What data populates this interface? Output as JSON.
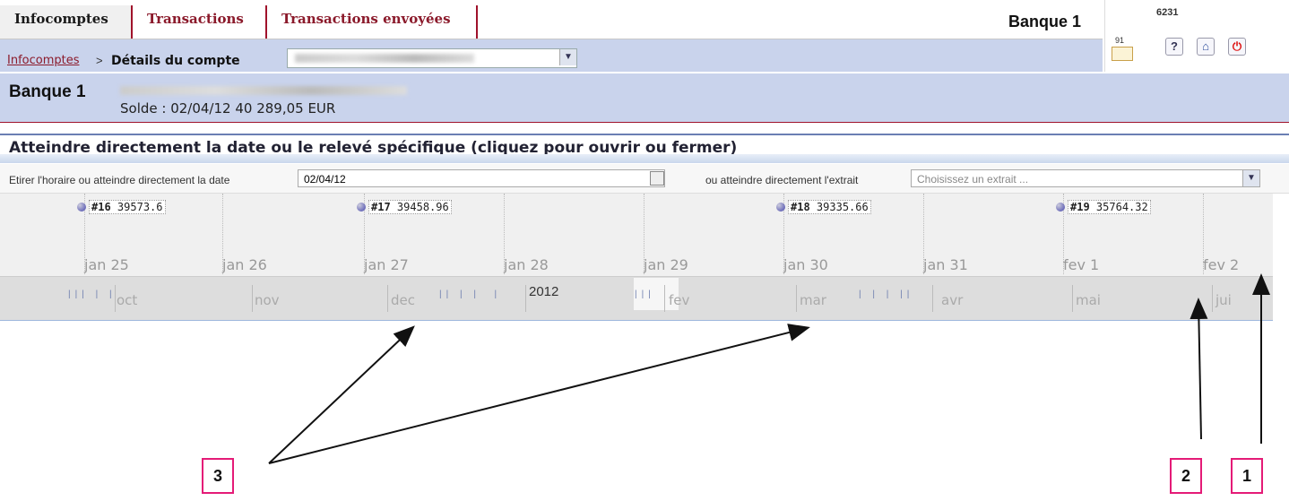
{
  "tabs": [
    {
      "label": "Infocomptes"
    },
    {
      "label": "Transactions"
    },
    {
      "label": "Transactions envoyées"
    }
  ],
  "header": {
    "bank": "Banque 1",
    "user_id": "6231",
    "message_count": "91"
  },
  "breadcrumb": {
    "link": "Infocomptes",
    "separator": ">",
    "current": "Détails du compte"
  },
  "account": {
    "bank": "Banque 1",
    "balance": "Solde : 02/04/12 40 289,05 EUR"
  },
  "section": {
    "title": "Atteindre directement la date ou le relevé spécifique (cliquez pour ouvrir ou fermer)"
  },
  "filter": {
    "label": "Etirer l'horaire ou atteindre directement la date",
    "date_value": "02/04/12",
    "extrait_label": "ou atteindre directement l'extrait",
    "extrait_placeholder": "Choisissez un extrait ..."
  },
  "timeline": {
    "days": [
      "jan 25",
      "jan 26",
      "jan 27",
      "jan 28",
      "jan 29",
      "jan 30",
      "jan 31",
      "fev 1",
      "fev 2"
    ],
    "events": [
      {
        "id": "#16",
        "value": "39573.6"
      },
      {
        "id": "#17",
        "value": "39458.96"
      },
      {
        "id": "#18",
        "value": "39335.66"
      },
      {
        "id": "#19",
        "value": "35764.32"
      }
    ],
    "months": [
      "oct",
      "nov",
      "dec",
      "fev",
      "mar",
      "avr",
      "mai",
      "jui"
    ],
    "year": "2012"
  },
  "callouts": [
    "3",
    "2",
    "1"
  ],
  "colors": {
    "accent": "#8b1a2b",
    "callout_border": "#e41b77",
    "header_band": "#c9d3ec"
  }
}
